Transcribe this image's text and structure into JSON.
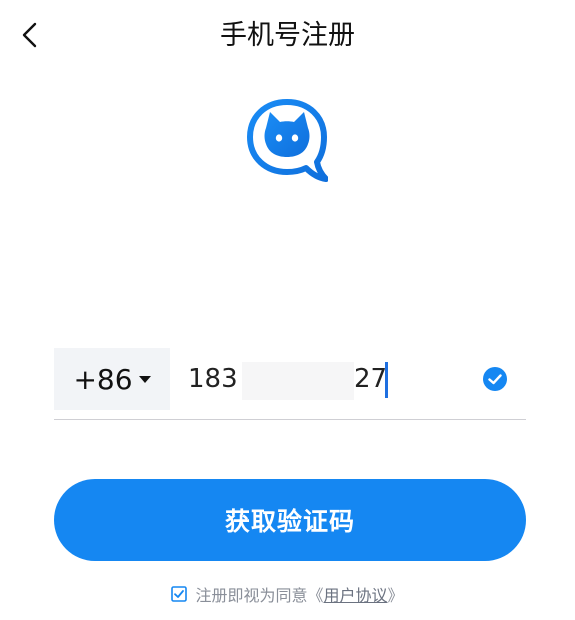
{
  "header": {
    "back_icon": "chevron-left-icon",
    "title": "手机号注册"
  },
  "logo": {
    "icon": "cat-chat-bubble-icon",
    "brand_color": "#1587f2"
  },
  "phone_form": {
    "country_code": "+86",
    "country_code_icon": "caret-down-icon",
    "phone_prefix": "183",
    "phone_suffix": "27",
    "valid_icon": "check-circle-icon",
    "valid_color": "#1587f2"
  },
  "actions": {
    "get_code_label": "获取验证码",
    "button_color": "#1587f2"
  },
  "agreement": {
    "checkbox_icon": "checkbox-checked-icon",
    "checked": true,
    "text": "注册即视为同意",
    "open_bracket": "《",
    "link_text": "用户协议",
    "close_bracket": "》"
  }
}
